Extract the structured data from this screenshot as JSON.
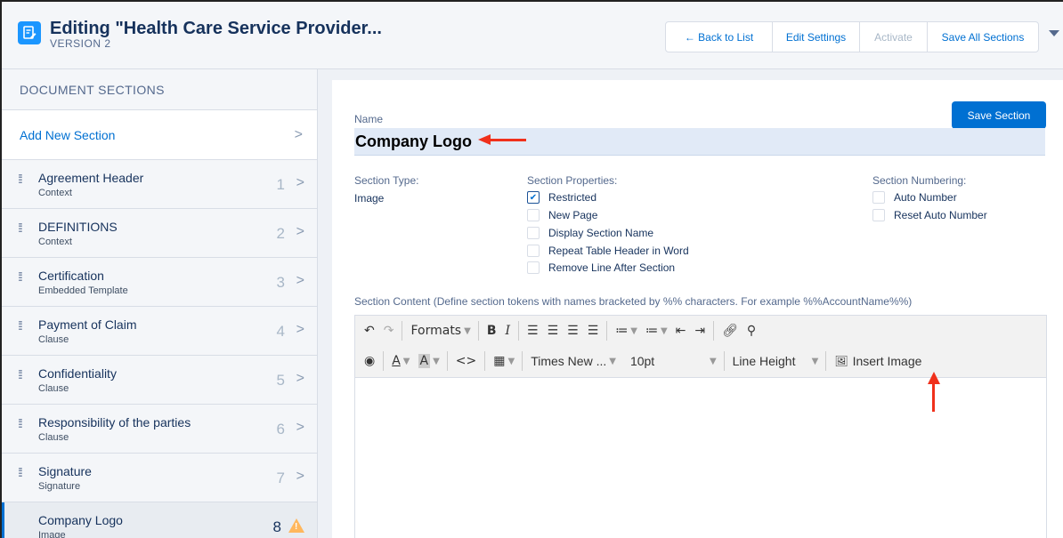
{
  "header": {
    "title": "Editing \"Health Care Service Provider...",
    "version": "VERSION 2",
    "buttons": {
      "back": "← Back to List",
      "edit_settings": "Edit Settings",
      "activate": "Activate",
      "save_all": "Save All Sections"
    }
  },
  "sidebar": {
    "heading": "DOCUMENT SECTIONS",
    "add_new": "Add New Section",
    "sections": [
      {
        "name": "Agreement Header",
        "type": "Context",
        "num": "1"
      },
      {
        "name": "DEFINITIONS",
        "type": "Context",
        "num": "2"
      },
      {
        "name": "Certification",
        "type": "Embedded Template",
        "num": "3"
      },
      {
        "name": "Payment of Claim",
        "type": "Clause",
        "num": "4"
      },
      {
        "name": "Confidentiality",
        "type": "Clause",
        "num": "5"
      },
      {
        "name": "Responsibility of the parties",
        "type": "Clause",
        "num": "6"
      },
      {
        "name": "Signature",
        "type": "Signature",
        "num": "7"
      },
      {
        "name": "Company Logo",
        "type": "Image",
        "num": "8"
      }
    ]
  },
  "main": {
    "name_label": "Name",
    "name_value": "Company Logo",
    "save_section": "Save Section",
    "section_type_label": "Section Type:",
    "section_type_value": "Image",
    "properties_label": "Section Properties:",
    "properties": [
      {
        "label": "Restricted",
        "checked": true
      },
      {
        "label": "New Page",
        "checked": false
      },
      {
        "label": "Display Section Name",
        "checked": false
      },
      {
        "label": "Repeat Table Header in Word",
        "checked": false
      },
      {
        "label": "Remove Line After Section",
        "checked": false
      }
    ],
    "numbering_label": "Section Numbering:",
    "numbering": [
      {
        "label": "Auto Number",
        "checked": false
      },
      {
        "label": "Reset Auto Number",
        "checked": false
      }
    ],
    "content_label": "Section Content (Define section tokens with names bracketed by %% characters. For example %%AccountName%%)",
    "toolbar": {
      "formats": "Formats",
      "font": "Times New ...",
      "size": "10pt",
      "line_height": "Line Height",
      "insert_image": "Insert Image"
    }
  },
  "colors": {
    "accent": "#0070d2",
    "annotation_arrow": "#f0301b",
    "warning": "#ffb75d"
  }
}
